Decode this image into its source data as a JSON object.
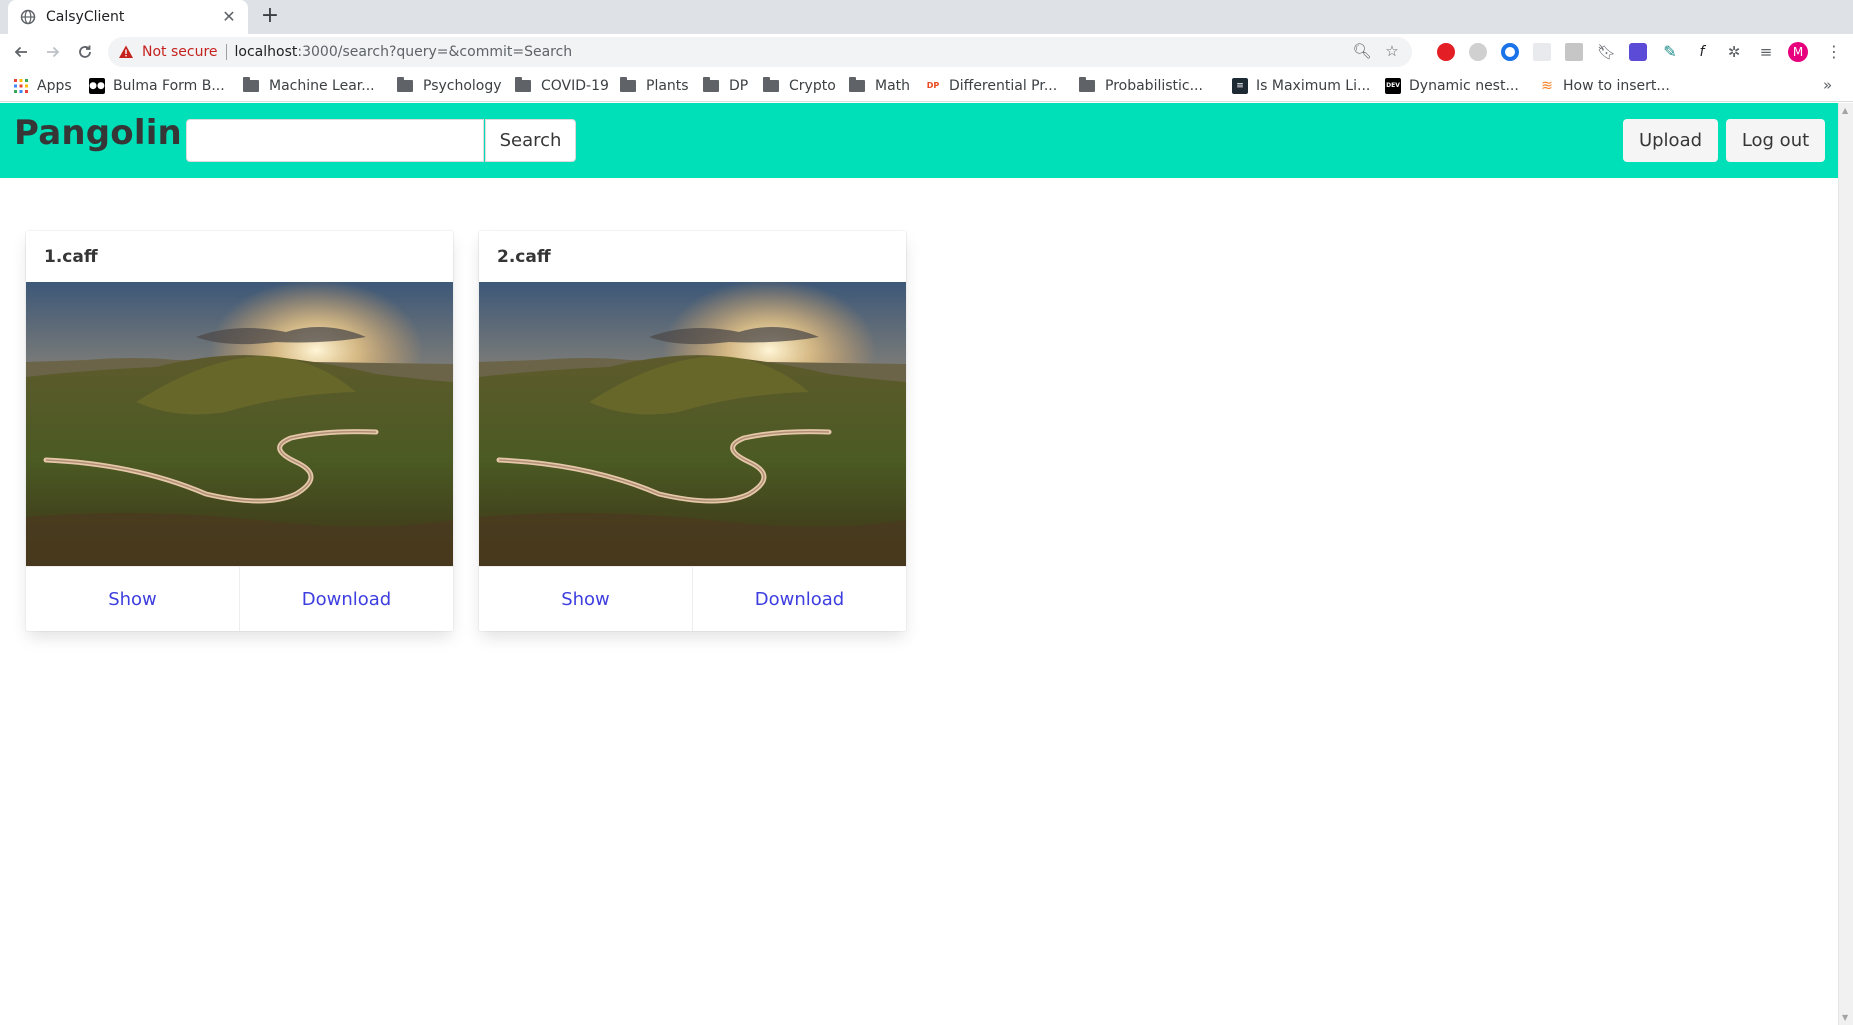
{
  "browser": {
    "tab_title": "CalsyClient",
    "security_label": "Not secure",
    "url_host": "localhost",
    "url_path": ":3000/search?query=&commit=Search",
    "profile_initial": "M"
  },
  "bookmarks": [
    {
      "label": "Apps",
      "icon": "apps-grid-icon"
    },
    {
      "label": "Bulma Form B...",
      "icon": "medium-icon"
    },
    {
      "label": "Machine Lear...",
      "icon": "folder-icon"
    },
    {
      "label": "Psychology",
      "icon": "folder-icon"
    },
    {
      "label": "COVID-19",
      "icon": "folder-icon"
    },
    {
      "label": "Plants",
      "icon": "folder-icon"
    },
    {
      "label": "DP",
      "icon": "folder-icon"
    },
    {
      "label": "Crypto",
      "icon": "folder-icon"
    },
    {
      "label": "Math",
      "icon": "folder-icon"
    },
    {
      "label": "Differential Pr...",
      "icon": "dp-site-icon"
    },
    {
      "label": "Probabilistic...",
      "icon": "folder-icon"
    },
    {
      "label": "Is Maximum Li...",
      "icon": "stackexchange-icon"
    },
    {
      "label": "Dynamic nest...",
      "icon": "dev-icon"
    },
    {
      "label": "How to insert...",
      "icon": "stackoverflow-icon"
    }
  ],
  "navbar": {
    "brand": "Pangolin",
    "search_value": "",
    "search_button": "Search",
    "upload_button": "Upload",
    "logout_button": "Log out",
    "accent_color": "#00e0b8"
  },
  "cards": [
    {
      "title": "1.caff",
      "show_label": "Show",
      "download_label": "Download"
    },
    {
      "title": "2.caff",
      "show_label": "Show",
      "download_label": "Download"
    }
  ]
}
